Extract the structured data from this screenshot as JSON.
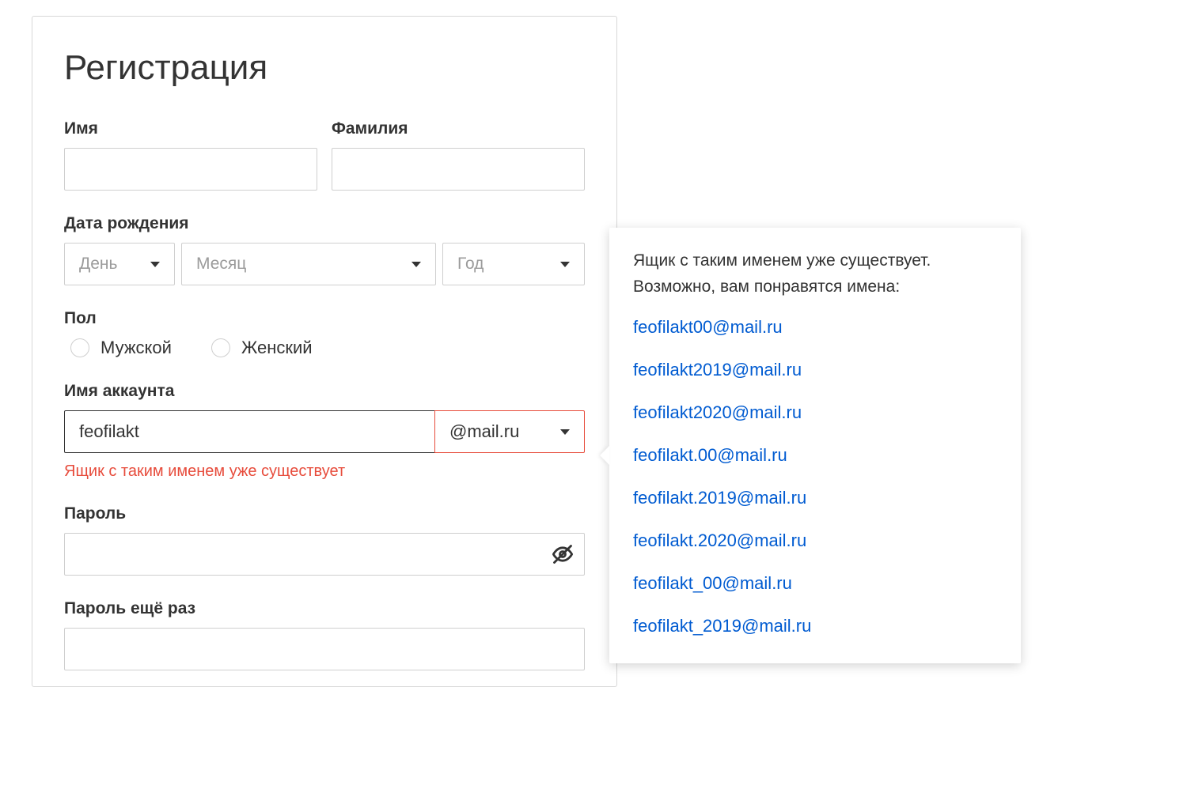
{
  "form": {
    "title": "Регистрация",
    "first_name_label": "Имя",
    "last_name_label": "Фамилия",
    "first_name_value": "",
    "last_name_value": "",
    "dob_label": "Дата рождения",
    "dob_day_placeholder": "День",
    "dob_month_placeholder": "Месяц",
    "dob_year_placeholder": "Год",
    "gender_label": "Пол",
    "gender_male": "Мужской",
    "gender_female": "Женский",
    "account_label": "Имя аккаунта",
    "account_value": "feofilakt",
    "domain_value": "@mail.ru",
    "account_error": "Ящик с таким именем уже существует",
    "password_label": "Пароль",
    "password_value": "",
    "password2_label": "Пароль ещё раз",
    "password2_value": ""
  },
  "popover": {
    "line1": "Ящик с таким именем уже существует.",
    "line2": "Возможно, вам понравятся имена:",
    "suggestions": [
      "feofilakt00@mail.ru",
      "feofilakt2019@mail.ru",
      "feofilakt2020@mail.ru",
      "feofilakt.00@mail.ru",
      "feofilakt.2019@mail.ru",
      "feofilakt.2020@mail.ru",
      "feofilakt_00@mail.ru",
      "feofilakt_2019@mail.ru"
    ]
  }
}
